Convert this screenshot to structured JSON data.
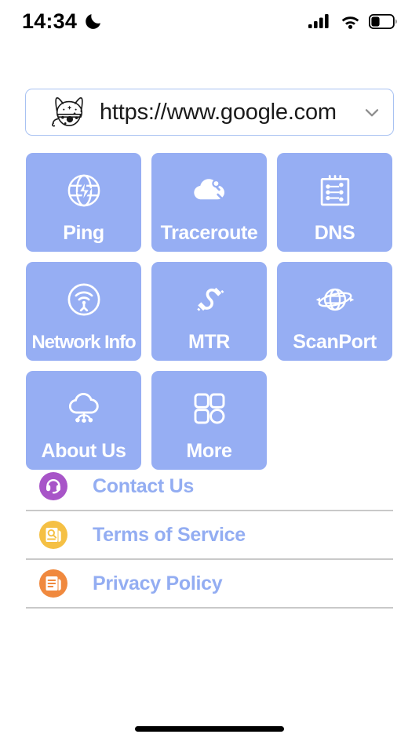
{
  "status_bar": {
    "time": "14:34",
    "dnd_icon": "crescent-moon-icon",
    "signal_icon": "cellular-signal-icon",
    "signal_bars_filled": 4,
    "wifi_icon": "wifi-icon",
    "battery_icon": "battery-icon",
    "battery_level_percent": 35
  },
  "url_bar": {
    "mascot_icon": "cat-mascot-icon",
    "value": "https://www.google.com",
    "placeholder": "https://www.google.com",
    "dropdown_icon": "chevron-down-icon"
  },
  "grid": {
    "tiles": [
      {
        "label": "Ping",
        "icon": "globe-lightning-icon"
      },
      {
        "label": "Traceroute",
        "icon": "cloud-route-icon"
      },
      {
        "label": "DNS",
        "icon": "clipboard-nodes-icon"
      },
      {
        "label": "Network Info",
        "icon": "wifi-circle-icon"
      },
      {
        "label": "MTR",
        "icon": "cable-plug-icon"
      },
      {
        "label": "ScanPort",
        "icon": "globe-arrow-icon"
      },
      {
        "label": "About Us",
        "icon": "cloud-nodes-icon"
      },
      {
        "label": "More",
        "icon": "grid-more-icon"
      }
    ]
  },
  "links": [
    {
      "label": "Contact Us",
      "icon": "headset-support-icon",
      "color": "#a855c8"
    },
    {
      "label": "Terms of Service",
      "icon": "document-search-icon",
      "color": "#f5c044"
    },
    {
      "label": "Privacy Policy",
      "icon": "document-lines-icon",
      "color": "#f0893e"
    }
  ],
  "colors": {
    "tile_background": "#96aef3",
    "link_text": "#93adf2",
    "divider": "#c9c9c9",
    "url_border": "#a8c2f2"
  },
  "home_indicator": {
    "name": "home-indicator"
  }
}
